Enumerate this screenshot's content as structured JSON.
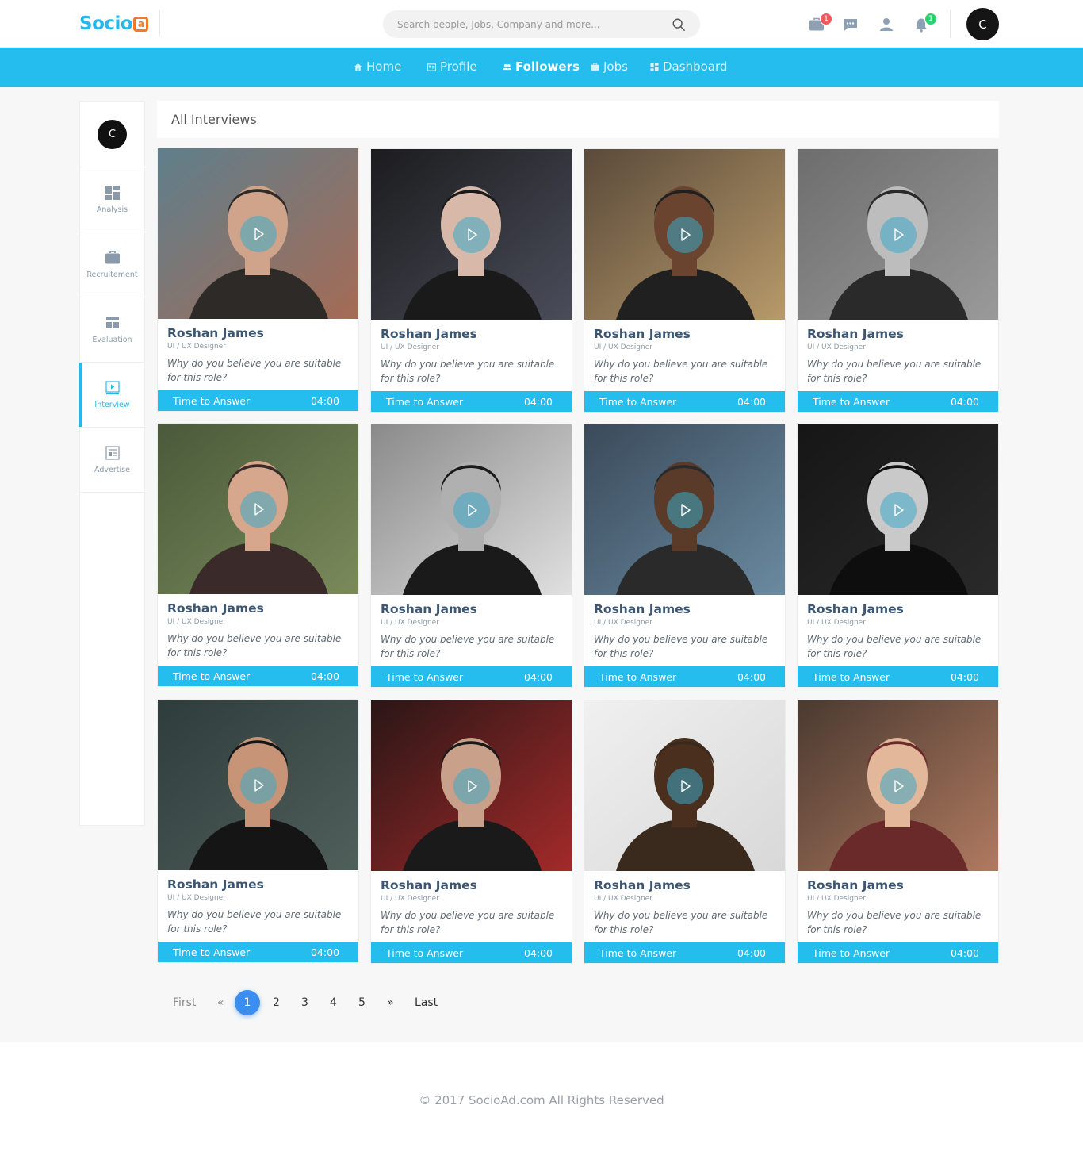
{
  "header": {
    "logo_text": "Socio",
    "logo_mark": "a",
    "search_placeholder": "Search people, Jobs, Company and more...",
    "icons": [
      {
        "name": "briefcase-icon",
        "badge": "1",
        "badge_color": "#f25b5b"
      },
      {
        "name": "chat-icon",
        "badge": ""
      },
      {
        "name": "person-icon",
        "badge": ""
      },
      {
        "name": "bell-icon",
        "badge": "1",
        "badge_color": "#2fcf6f"
      }
    ],
    "avatar_initial": "C"
  },
  "nav": {
    "items": [
      {
        "label": "Home",
        "icon": "home-icon",
        "active": false
      },
      {
        "label": "Profile",
        "icon": "profile-icon",
        "active": false
      },
      {
        "label": "Followers",
        "icon": "followers-icon",
        "active": true
      },
      {
        "label": "Jobs",
        "icon": "jobs-icon",
        "active": false
      },
      {
        "label": "Dashboard",
        "icon": "dashboard-icon",
        "active": false
      }
    ]
  },
  "sidebar": {
    "avatar_initial": "C",
    "items": [
      {
        "label": "Analysis",
        "icon": "analysis-icon",
        "active": false
      },
      {
        "label": "Recruitement",
        "icon": "briefcase-icon",
        "active": false
      },
      {
        "label": "Evaluation",
        "icon": "evaluation-icon",
        "active": false
      },
      {
        "label": "Interview",
        "icon": "video-icon",
        "active": true
      },
      {
        "label": "Advertise",
        "icon": "advertise-icon",
        "active": false
      }
    ]
  },
  "main": {
    "title": "All Interviews",
    "cards": [
      {
        "name": "Roshan James",
        "role": "UI / UX Designer",
        "question": "Why do you believe you are suitable for this role?",
        "answer_label": "Time to Answer",
        "time": "04:00"
      },
      {
        "name": "Roshan James",
        "role": "UI / UX Designer",
        "question": "Why do you believe you are suitable for this role?",
        "answer_label": "Time to Answer",
        "time": "04:00"
      },
      {
        "name": "Roshan James",
        "role": "UI / UX Designer",
        "question": "Why do you believe you are suitable for this role?",
        "answer_label": "Time to Answer",
        "time": "04:00"
      },
      {
        "name": "Roshan James",
        "role": "UI / UX Designer",
        "question": "Why do you believe you are suitable for this role?",
        "answer_label": "Time to Answer",
        "time": "04:00"
      },
      {
        "name": "Roshan James",
        "role": "UI / UX Designer",
        "question": "Why do you believe you are suitable for this role?",
        "answer_label": "Time to Answer",
        "time": "04:00"
      },
      {
        "name": "Roshan James",
        "role": "UI / UX Designer",
        "question": "Why do you believe you are suitable for this role?",
        "answer_label": "Time to Answer",
        "time": "04:00"
      },
      {
        "name": "Roshan James",
        "role": "UI / UX Designer",
        "question": "Why do you believe you are suitable for this role?",
        "answer_label": "Time to Answer",
        "time": "04:00"
      },
      {
        "name": "Roshan James",
        "role": "UI / UX Designer",
        "question": "Why do you believe you are suitable for this role?",
        "answer_label": "Time to Answer",
        "time": "04:00"
      },
      {
        "name": "Roshan James",
        "role": "UI / UX Designer",
        "question": "Why do you believe you are suitable for this role?",
        "answer_label": "Time to Answer",
        "time": "04:00"
      },
      {
        "name": "Roshan James",
        "role": "UI / UX Designer",
        "question": "Why do you believe you are suitable for this role?",
        "answer_label": "Time to Answer",
        "time": "04:00"
      },
      {
        "name": "Roshan James",
        "role": "UI / UX Designer",
        "question": "Why do you believe you are suitable for this role?",
        "answer_label": "Time to Answer",
        "time": "04:00"
      },
      {
        "name": "Roshan James",
        "role": "UI / UX Designer",
        "question": "Why do you believe you are suitable for this role?",
        "answer_label": "Time to Answer",
        "time": "04:00"
      }
    ]
  },
  "pagination": {
    "first": "First",
    "prev": "«",
    "pages": [
      "1",
      "2",
      "3",
      "4",
      "5"
    ],
    "current": "1",
    "next": "»",
    "last": "Last"
  },
  "footer": {
    "copyright": "© 2017 SocioAd.com All Rights Reserved"
  },
  "colors": {
    "accent": "#25bdee",
    "brand_orange": "#f27a2a",
    "name_text": "#3d5772",
    "pagination_active": "#3b8ef0"
  }
}
